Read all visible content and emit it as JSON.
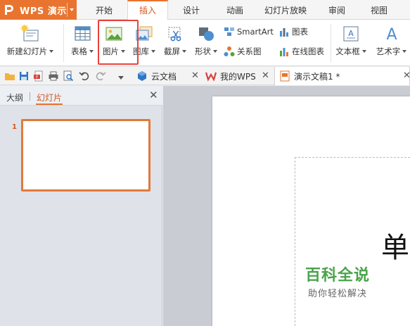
{
  "app": {
    "name": "WPS 演示"
  },
  "tabs": [
    {
      "label": "开始"
    },
    {
      "label": "插入"
    },
    {
      "label": "设计"
    },
    {
      "label": "动画"
    },
    {
      "label": "幻灯片放映"
    },
    {
      "label": "审阅"
    },
    {
      "label": "视图"
    }
  ],
  "ribbon": {
    "new_slide": "新建幻灯片",
    "table": "表格",
    "picture": "图片",
    "gallery": "图库",
    "screenshot": "截屏",
    "shape": "形状",
    "smartart": "SmartArt",
    "relation": "关系图",
    "chart": "图表",
    "online_chart": "在线图表",
    "textbox": "文本框",
    "wordart": "艺术字"
  },
  "doc_tabs": [
    {
      "label": "云文档"
    },
    {
      "label": "我的WPS"
    },
    {
      "label": "演示文稿1 *"
    }
  ],
  "left_panel": {
    "tab_outline": "大纲",
    "tab_slides": "幻灯片",
    "slide_number": "1"
  },
  "slide": {
    "visible_char": "单"
  },
  "watermark": {
    "title": "百科全说",
    "subtitle": "助你轻松解决"
  },
  "colors": {
    "accent": "#e8742f",
    "highlight": "#e8413c",
    "watermark": "#4aa34a"
  }
}
